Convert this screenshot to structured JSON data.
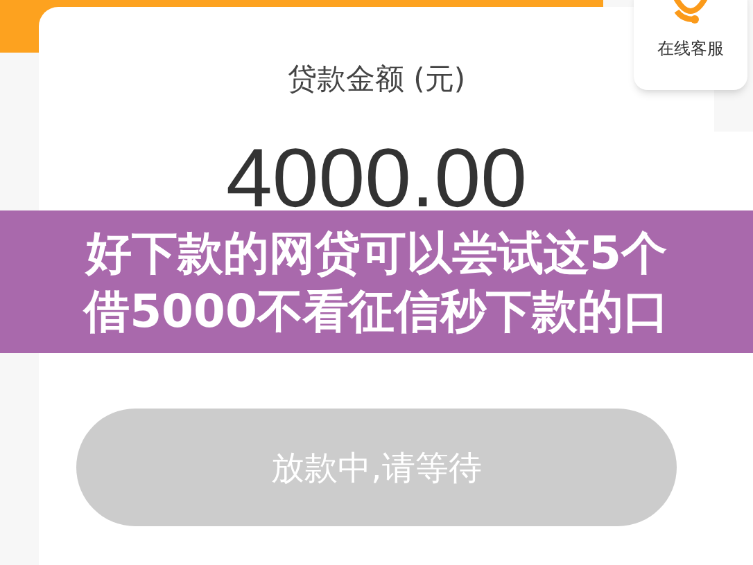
{
  "service": {
    "label": "在线客服"
  },
  "loan": {
    "label": "贷款金额 (元)",
    "amount": "4000.00"
  },
  "banner": {
    "lines": [
      "好下款的网贷可以尝试这5个",
      "借5000不看征信秒下款的口"
    ]
  },
  "button": {
    "label": "放款中,请等待",
    "disabled": true
  }
}
